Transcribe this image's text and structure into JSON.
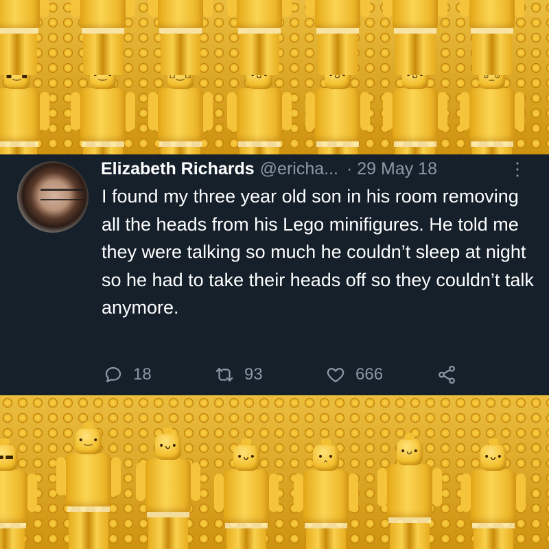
{
  "tweet": {
    "author_name": "Elizabeth Richards",
    "handle": "@ericha...",
    "date": "· 29 May 18",
    "more_icon": "⋮",
    "text": "I found my three year old son in his room removing all the heads from his Lego minifigures. He told me they were talking so much he couldn’t sleep at night so he had to take their heads off so they couldn’t talk anymore.",
    "actions": {
      "reply_count": "18",
      "retweet_count": "93",
      "like_count": "666"
    }
  },
  "icons": [
    "reply-icon",
    "retweet-icon",
    "like-icon",
    "share-icon",
    "more-options-icon"
  ],
  "colors": {
    "tweet_background": "#15202b",
    "secondary_text": "#8b98a5",
    "lego_yellow": "#f1bd2c"
  }
}
